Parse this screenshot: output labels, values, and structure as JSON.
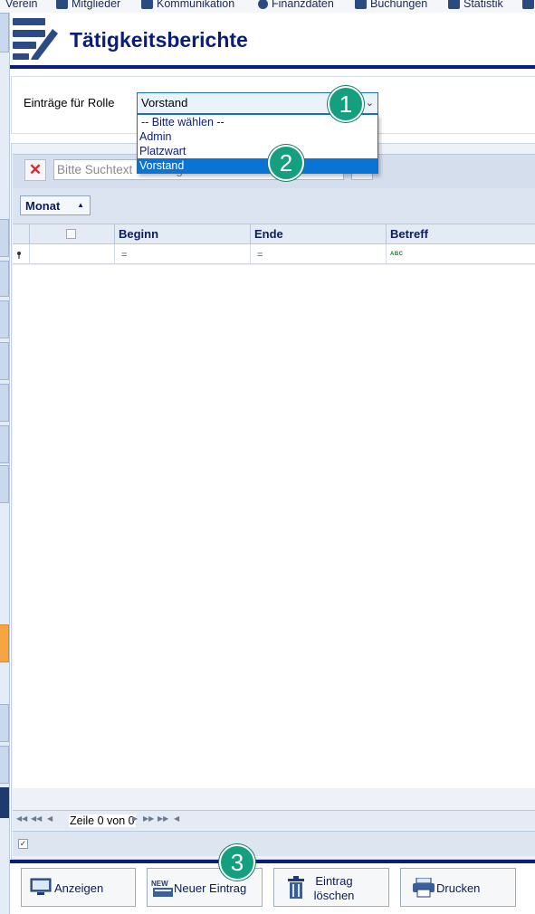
{
  "menubar": {
    "items": [
      {
        "label": "Verein",
        "icon": "none"
      },
      {
        "label": "Mitglieder",
        "icon": "members-icon"
      },
      {
        "label": "Kommunikation",
        "icon": "mail-icon"
      },
      {
        "label": "Finanzdaten",
        "icon": "euro-icon"
      },
      {
        "label": "Buchungen",
        "icon": "booking-icon"
      },
      {
        "label": "Statistik",
        "icon": "chart-icon"
      }
    ]
  },
  "header": {
    "title": "Tätigkeitsberichte",
    "icon": "report-edit-icon",
    "accent_color": "#0b1d7a"
  },
  "role_filter": {
    "label": "Einträge für Rolle",
    "selected": "Vorstand",
    "options": [
      "-- Bitte wählen --",
      "Admin",
      "Platzwart",
      "Vorstand"
    ]
  },
  "search": {
    "placeholder": "Bitte Suchtext hier eingeben..."
  },
  "grouping": {
    "chip_label": "Monat"
  },
  "grid": {
    "columns": [
      "Beginn",
      "Ende",
      "Betreff"
    ],
    "filter_ops": [
      "=",
      "="
    ],
    "filter_abc_label": "ABC"
  },
  "pager": {
    "row_text": "Zeile 0 von 0"
  },
  "actions": {
    "show_label": "Anzeigen",
    "new_label": "Neuer Eintrag",
    "delete_label_line1": "Eintrag",
    "delete_label_line2": "löschen",
    "print_label": "Drucken"
  },
  "callouts": [
    "1",
    "2",
    "3"
  ],
  "colors": {
    "selection": "#0a74d6",
    "callout": "#14a07f"
  }
}
